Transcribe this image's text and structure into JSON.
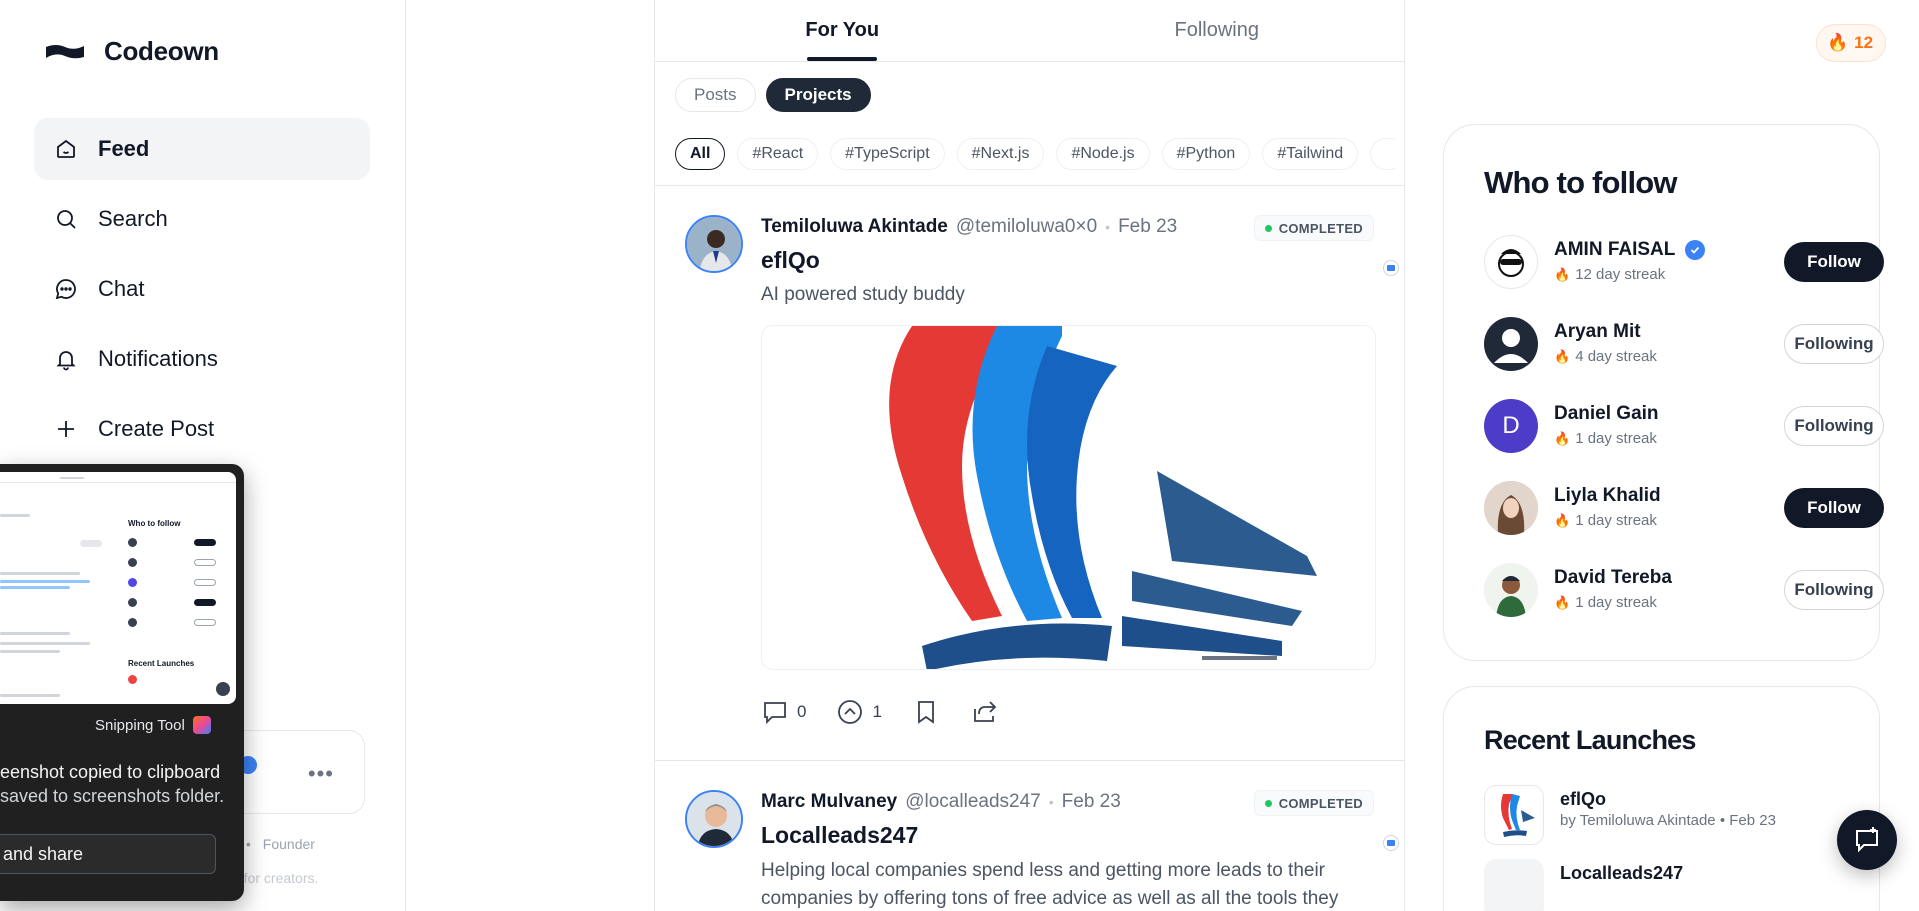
{
  "brand": {
    "name": "Codeown"
  },
  "nav": {
    "items": [
      {
        "label": "Feed",
        "icon": "home-icon",
        "active": true
      },
      {
        "label": "Search",
        "icon": "search-icon"
      },
      {
        "label": "Chat",
        "icon": "chat-icon"
      },
      {
        "label": "Notifications",
        "icon": "bell-icon"
      },
      {
        "label": "Create Post",
        "icon": "plus-icon"
      }
    ]
  },
  "sidebar_footer": {
    "link_partial": "t",
    "link_founder": "Founder",
    "tagline_partial": "d for creators."
  },
  "snipping_tool": {
    "app_name": "Snipping Tool",
    "message_line1": "eenshot copied to clipboard",
    "message_line2": " saved to screenshots folder.",
    "share_button": " and share",
    "thumb": {
      "who_to_follow": "Who to follow",
      "recent_launches": "Recent Launches"
    }
  },
  "feed": {
    "tabs": [
      {
        "label": "For You",
        "active": true
      },
      {
        "label": "Following"
      }
    ],
    "segments": [
      {
        "label": "Posts"
      },
      {
        "label": "Projects",
        "active": true
      }
    ],
    "tags": [
      "All",
      "#React",
      "#TypeScript",
      "#Next.js",
      "#Node.js",
      "#Python",
      "#Tailwind"
    ],
    "posts": [
      {
        "author": "Temiloluwa Akintade",
        "handle": "@temiloluwa0×0",
        "date": "Feb 23",
        "status": "COMPLETED",
        "title": "eflQo",
        "description": "AI powered study buddy",
        "comments": "0",
        "upvotes": "1"
      },
      {
        "author": "Marc Mulvaney",
        "handle": "@localleads247",
        "date": "Feb 23",
        "status": "COMPLETED",
        "title": "Localleads247",
        "description": "Helping local companies spend less and getting more leads to their companies by offering tons of free advice as well as all the tools they"
      }
    ]
  },
  "streak": {
    "count": "12"
  },
  "who_to_follow": {
    "title": "Who to follow",
    "users": [
      {
        "name": "AMIN FAISAL",
        "verified": true,
        "streak": "12 day streak",
        "button": "Follow",
        "following": false
      },
      {
        "name": "Aryan Mit",
        "streak": "4 day streak",
        "button": "Following",
        "following": true
      },
      {
        "name": "Daniel Gain",
        "streak": "1 day streak",
        "button": "Following",
        "following": true,
        "initial": "D"
      },
      {
        "name": "Liyla Khalid",
        "streak": "1 day streak",
        "button": "Follow",
        "following": false
      },
      {
        "name": "David Tereba",
        "streak": "1 day streak",
        "button": "Following",
        "following": true
      }
    ]
  },
  "recent_launches": {
    "title": "Recent Launches",
    "items": [
      {
        "name": "eflQo",
        "meta": "by Temiloluwa Akintade • Feb 23"
      },
      {
        "name": "Localleads247"
      }
    ]
  },
  "colors": {
    "accent": "#111827",
    "verified": "#3b82f6",
    "streak": "#f97316",
    "completed": "#22c55e"
  }
}
